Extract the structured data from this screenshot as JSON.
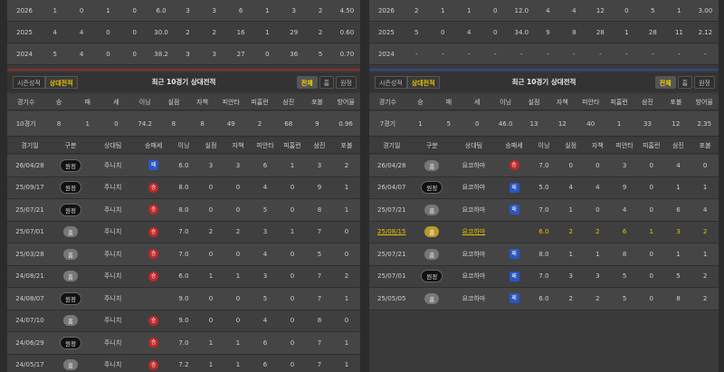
{
  "left": {
    "yearly": [
      [
        "2026",
        "1",
        "0",
        "1",
        "0",
        "6.0",
        "3",
        "3",
        "6",
        "1",
        "3",
        "2",
        "4.50"
      ],
      [
        "2025",
        "4",
        "4",
        "0",
        "0",
        "30.0",
        "2",
        "2",
        "16",
        "1",
        "29",
        "2",
        "0.60"
      ],
      [
        "2024",
        "5",
        "4",
        "0",
        "0",
        "38.2",
        "3",
        "3",
        "27",
        "0",
        "36",
        "5",
        "0.70"
      ]
    ],
    "tabs_left": [
      "시즌성적",
      "상대전적"
    ],
    "title": "최근 10경기 상대전적",
    "tabs_right": [
      "전체",
      "홈",
      "원정"
    ],
    "summary_head": [
      "경기수",
      "승",
      "패",
      "세",
      "이닝",
      "실점",
      "자책",
      "피안타",
      "피홈런",
      "삼진",
      "포볼",
      "방어율"
    ],
    "summary_vals": [
      "10경기",
      "8",
      "1",
      "0",
      "74.2",
      "8",
      "8",
      "49",
      "2",
      "68",
      "9",
      "0.96"
    ],
    "games_head": [
      "경기일",
      "구분",
      "상대팀",
      "승패세",
      "이닝",
      "실점",
      "자책",
      "피안타",
      "피홈런",
      "삼진",
      "포볼"
    ],
    "games": [
      {
        "date": "26/04/28",
        "loc": "원정",
        "locType": "away",
        "opp": "주니치",
        "res": "패",
        "resType": "l",
        "n": [
          "6.0",
          "3",
          "3",
          "6",
          "1",
          "3",
          "2"
        ]
      },
      {
        "date": "25/09/17",
        "loc": "원정",
        "locType": "away",
        "opp": "주니치",
        "res": "승",
        "resType": "w",
        "n": [
          "8.0",
          "0",
          "0",
          "4",
          "0",
          "9",
          "1"
        ]
      },
      {
        "date": "25/07/21",
        "loc": "원정",
        "locType": "away",
        "opp": "주니치",
        "res": "승",
        "resType": "w",
        "n": [
          "8.0",
          "0",
          "0",
          "5",
          "0",
          "8",
          "1"
        ]
      },
      {
        "date": "25/07/01",
        "loc": "홈",
        "locType": "home",
        "opp": "주니치",
        "res": "승",
        "resType": "w",
        "n": [
          "7.0",
          "2",
          "2",
          "3",
          "1",
          "7",
          "0"
        ]
      },
      {
        "date": "25/03/28",
        "loc": "홈",
        "locType": "home",
        "opp": "주니치",
        "res": "승",
        "resType": "w",
        "n": [
          "7.0",
          "0",
          "0",
          "4",
          "0",
          "5",
          "0"
        ]
      },
      {
        "date": "24/08/21",
        "loc": "홈",
        "locType": "home",
        "opp": "주니치",
        "res": "승",
        "resType": "w",
        "n": [
          "6.0",
          "1",
          "1",
          "3",
          "0",
          "7",
          "2"
        ]
      },
      {
        "date": "24/08/07",
        "loc": "원정",
        "locType": "away",
        "opp": "주니치",
        "res": "",
        "resType": "",
        "n": [
          "9.0",
          "0",
          "0",
          "5",
          "0",
          "7",
          "1"
        ]
      },
      {
        "date": "24/07/10",
        "loc": "홈",
        "locType": "home",
        "opp": "주니치",
        "res": "승",
        "resType": "w",
        "n": [
          "9.0",
          "0",
          "0",
          "4",
          "0",
          "8",
          "0"
        ]
      },
      {
        "date": "24/06/29",
        "loc": "원정",
        "locType": "away",
        "opp": "주니치",
        "res": "승",
        "resType": "w",
        "n": [
          "7.0",
          "1",
          "1",
          "6",
          "0",
          "7",
          "1"
        ]
      },
      {
        "date": "24/05/17",
        "loc": "홈",
        "locType": "home",
        "opp": "주니치",
        "res": "승",
        "resType": "w",
        "n": [
          "7.2",
          "1",
          "1",
          "6",
          "0",
          "7",
          "1"
        ]
      }
    ]
  },
  "right": {
    "yearly": [
      [
        "2026",
        "2",
        "1",
        "1",
        "0",
        "12.0",
        "4",
        "4",
        "12",
        "0",
        "5",
        "1",
        "3.00"
      ],
      [
        "2025",
        "5",
        "0",
        "4",
        "0",
        "34.0",
        "9",
        "8",
        "28",
        "1",
        "28",
        "11",
        "2.12"
      ],
      [
        "2024",
        "-",
        "-",
        "-",
        "-",
        "-",
        "-",
        "-",
        "-",
        "-",
        "-",
        "-",
        "-"
      ]
    ],
    "tabs_left": [
      "시즌성적",
      "상대전적"
    ],
    "title": "최근 10경기 상대전적",
    "tabs_right": [
      "전체",
      "홈",
      "원정"
    ],
    "summary_head": [
      "경기수",
      "승",
      "패",
      "세",
      "이닝",
      "실점",
      "자책",
      "피안타",
      "피홈런",
      "삼진",
      "포볼",
      "방어율"
    ],
    "summary_vals": [
      "7경기",
      "1",
      "5",
      "0",
      "46.0",
      "13",
      "12",
      "40",
      "1",
      "33",
      "12",
      "2.35"
    ],
    "games_head": [
      "경기일",
      "구분",
      "상대팀",
      "승패세",
      "이닝",
      "실점",
      "자책",
      "피안타",
      "피홈런",
      "삼진",
      "포볼"
    ],
    "games": [
      {
        "date": "26/04/28",
        "loc": "홈",
        "locType": "home",
        "opp": "요코하마",
        "res": "승",
        "resType": "w",
        "n": [
          "7.0",
          "0",
          "0",
          "3",
          "0",
          "4",
          "0"
        ]
      },
      {
        "date": "26/04/07",
        "loc": "원정",
        "locType": "away",
        "opp": "요코하마",
        "res": "패",
        "resType": "l",
        "n": [
          "5.0",
          "4",
          "4",
          "9",
          "0",
          "1",
          "1"
        ]
      },
      {
        "date": "25/07/21",
        "loc": "홈",
        "locType": "home",
        "opp": "요코하마",
        "res": "패",
        "resType": "l",
        "n": [
          "7.0",
          "1",
          "0",
          "4",
          "0",
          "6",
          "4"
        ]
      },
      {
        "date": "25/08/15",
        "loc": "홈",
        "locType": "hl",
        "opp": "요코하마",
        "res": "",
        "resType": "",
        "n": [
          "6.0",
          "2",
          "2",
          "6",
          "1",
          "3",
          "2"
        ],
        "hl": true
      },
      {
        "date": "25/07/21",
        "loc": "홈",
        "locType": "home",
        "opp": "요코하마",
        "res": "패",
        "resType": "l",
        "n": [
          "8.0",
          "1",
          "1",
          "8",
          "0",
          "1",
          "1"
        ]
      },
      {
        "date": "25/07/01",
        "loc": "원정",
        "locType": "away",
        "opp": "요코하마",
        "res": "패",
        "resType": "l",
        "n": [
          "7.0",
          "3",
          "3",
          "5",
          "0",
          "5",
          "2"
        ]
      },
      {
        "date": "25/05/05",
        "loc": "홈",
        "locType": "home",
        "opp": "요코하마",
        "res": "패",
        "resType": "l",
        "n": [
          "6.0",
          "2",
          "2",
          "5",
          "0",
          "8",
          "2"
        ]
      }
    ]
  }
}
